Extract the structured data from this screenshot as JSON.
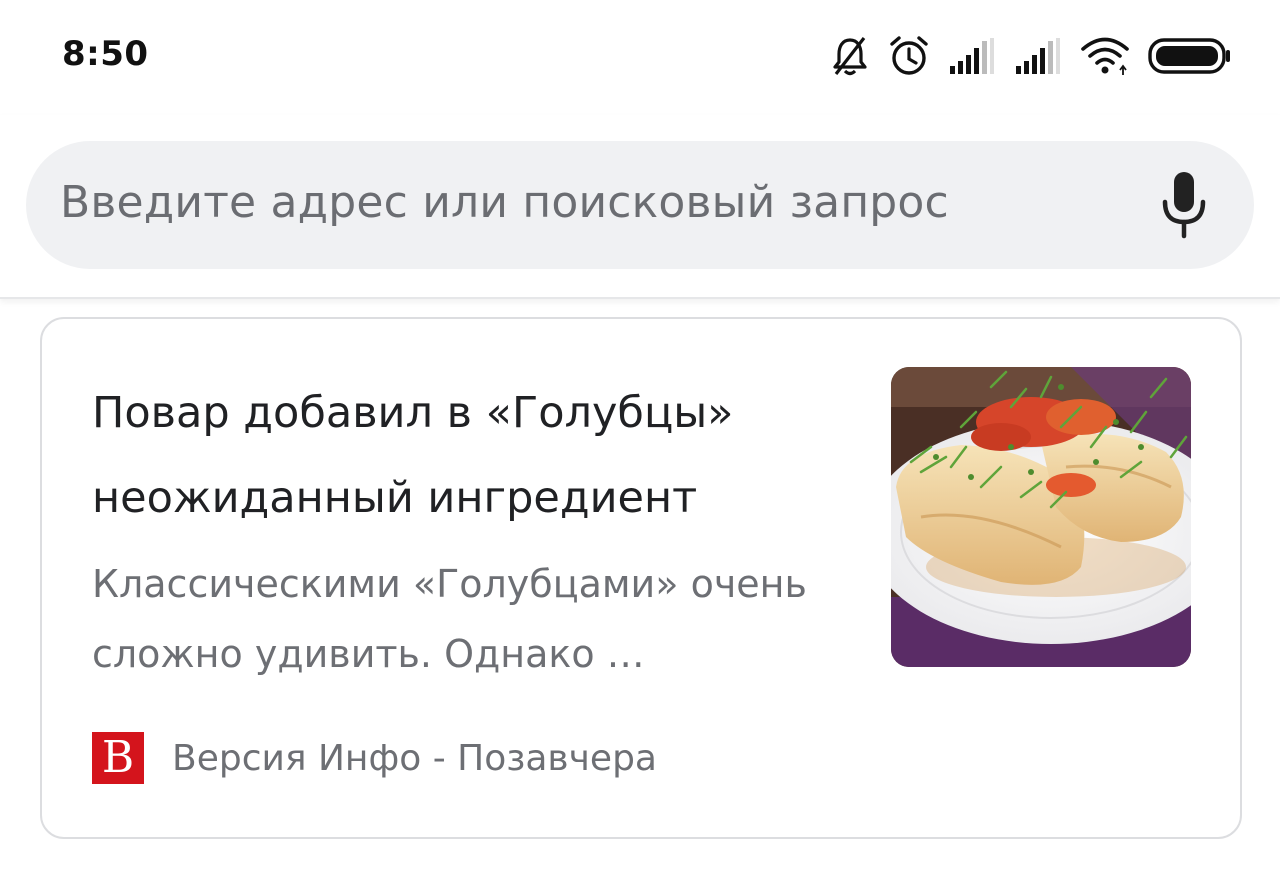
{
  "status_bar": {
    "time": "8:50",
    "icons": [
      "bell-off-icon",
      "alarm-icon",
      "signal-icon",
      "signal-icon",
      "wifi-icon",
      "battery-icon"
    ]
  },
  "search": {
    "placeholder": "Введите адрес или поисковый запрос",
    "mic_icon": "microphone-icon"
  },
  "article": {
    "title": "Повар добавил в «Голубцы» неожиданный ингредиент",
    "snippet": "Классическими «Голубцами» очень сложно удивить. Однако …",
    "logo_letter": "B",
    "source": "Версия Инфо - Позавчера",
    "image": "photo of cabbage rolls with tomato and dill on a white plate"
  },
  "colors": {
    "search_bg": "#f0f1f3",
    "logo_red": "#d4141c",
    "text_secondary": "#6d6f74"
  }
}
